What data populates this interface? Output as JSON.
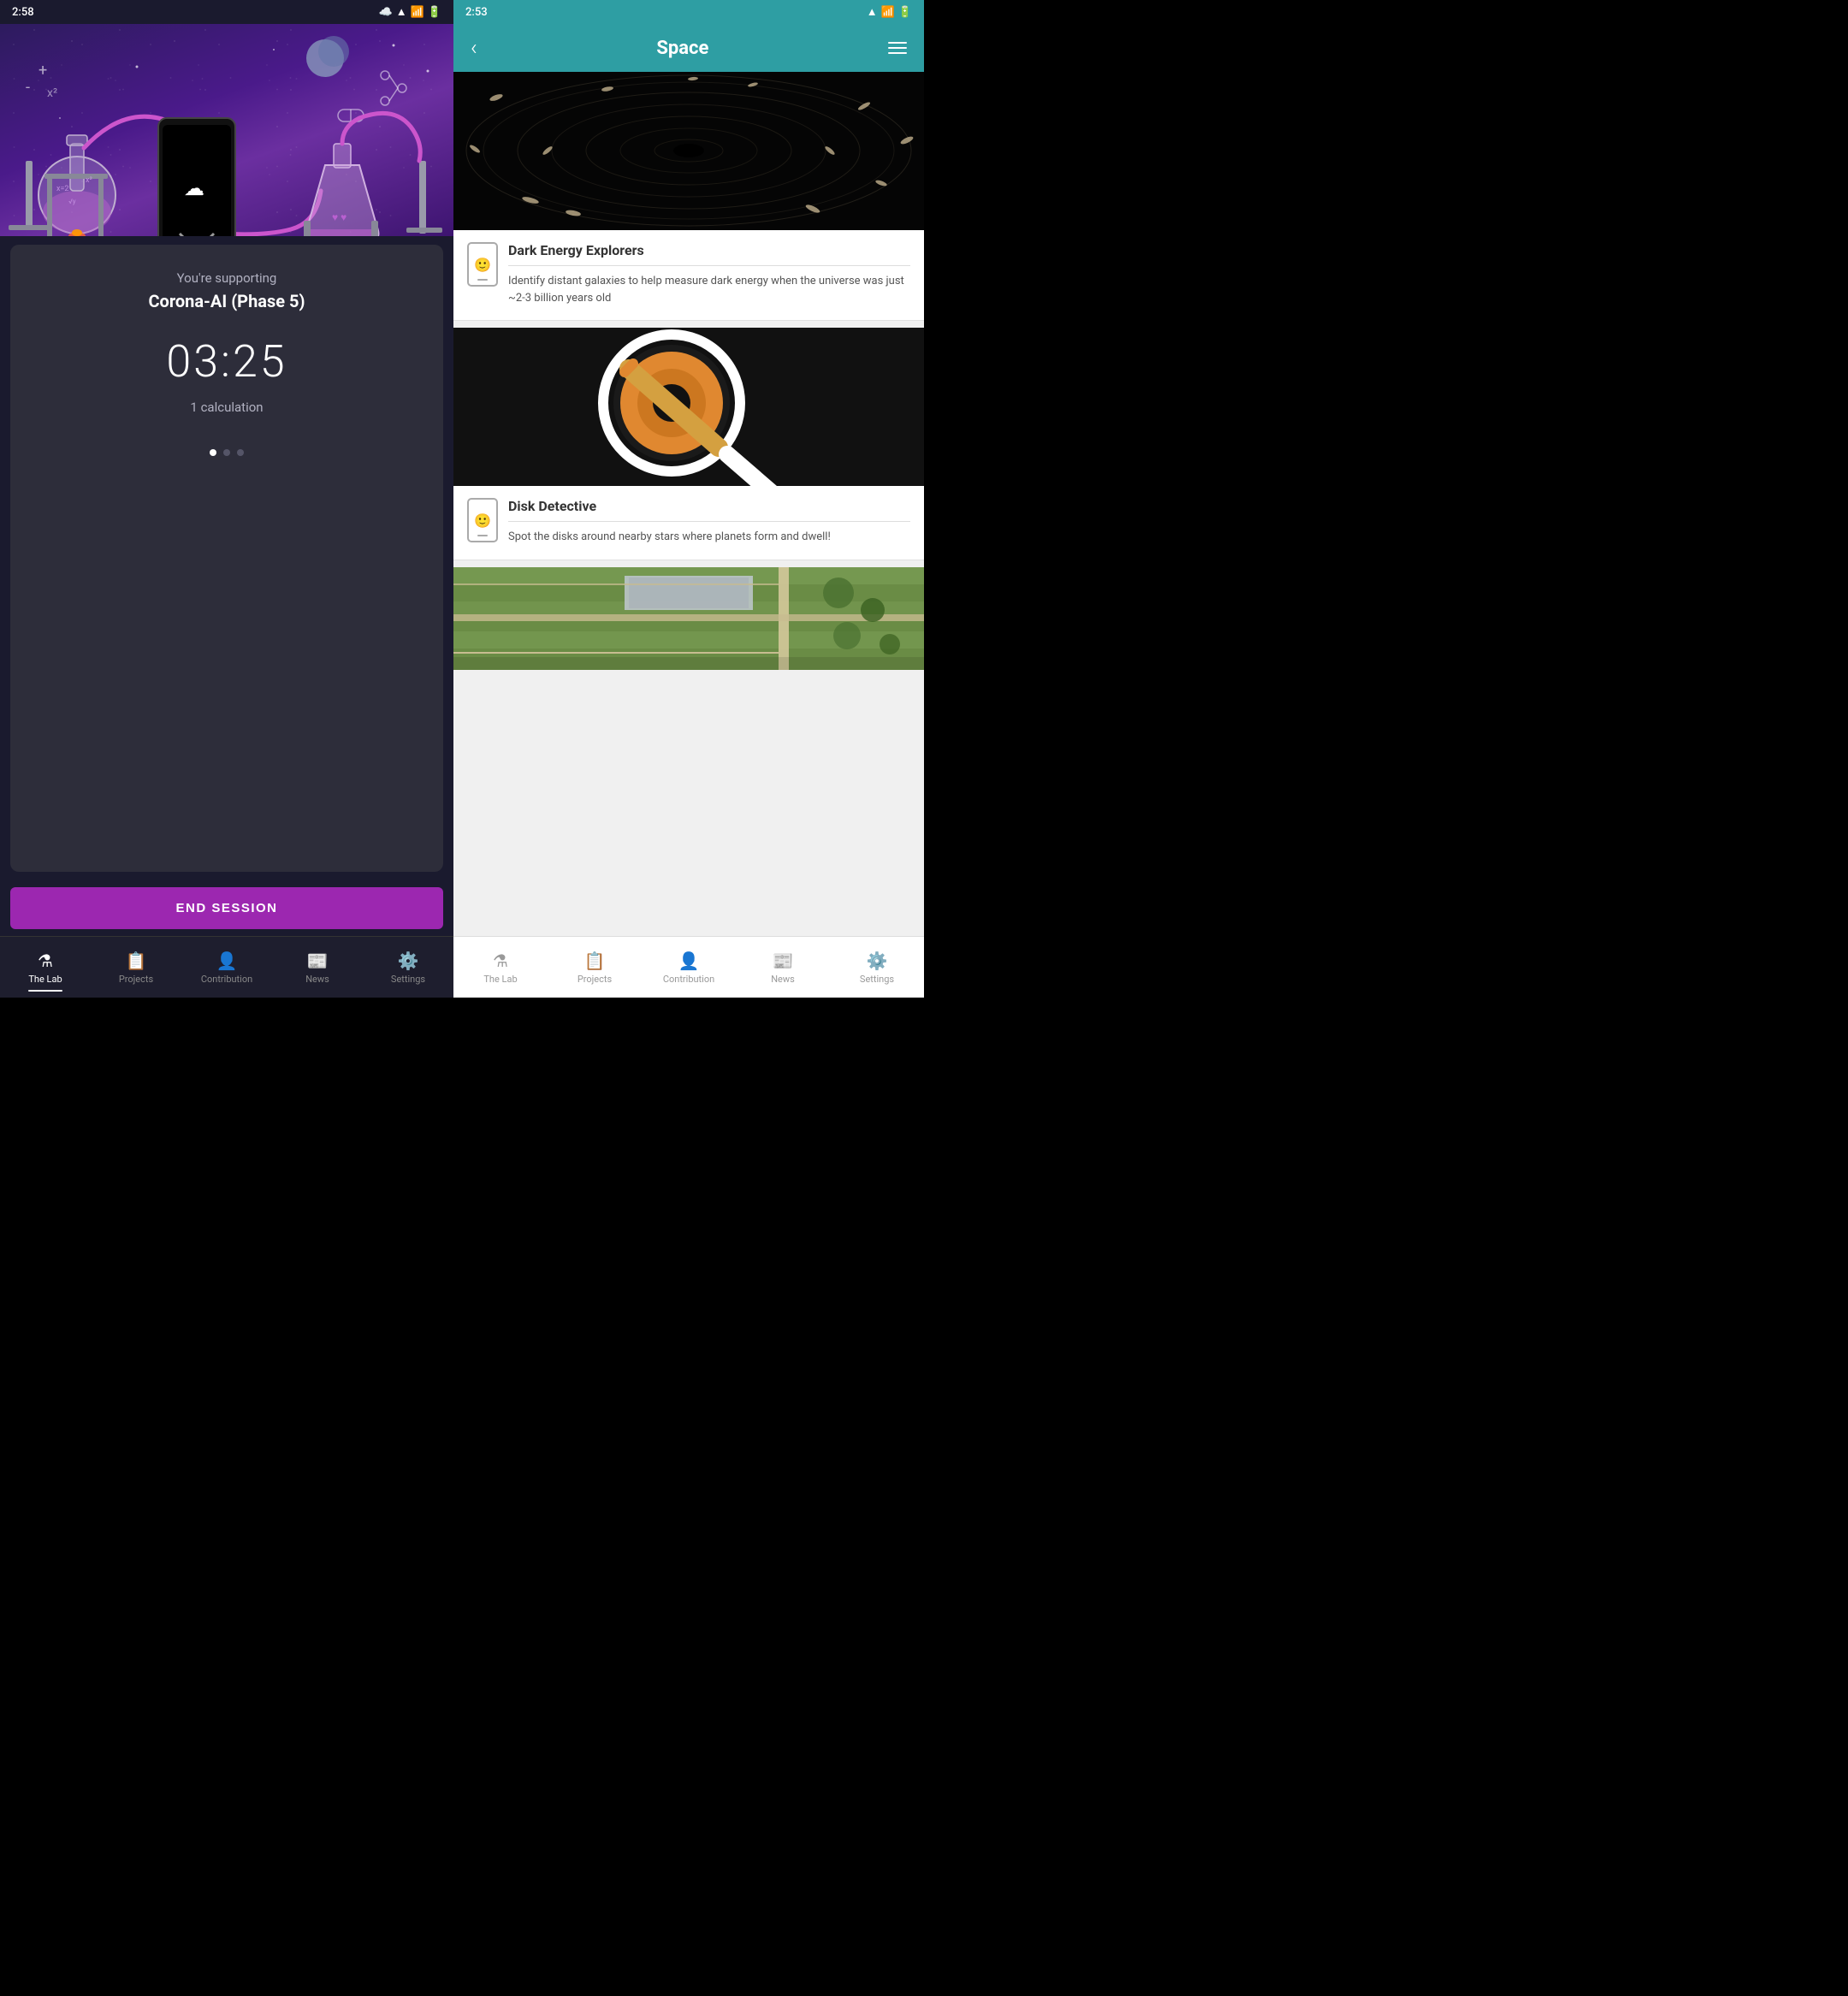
{
  "left": {
    "status_bar": {
      "time": "2:58",
      "icons": [
        "cloud",
        "wifi",
        "signal",
        "battery"
      ]
    },
    "hero": {
      "alt": "Lab illustration with science equipment"
    },
    "info_card": {
      "supporting_label": "You're supporting",
      "project_name": "Corona-AI (Phase 5)",
      "timer": "03:25",
      "calculation_label": "1 calculation",
      "dots": [
        true,
        false,
        false
      ]
    },
    "end_session_button": "END SESSION",
    "nav": {
      "items": [
        {
          "id": "the-lab",
          "label": "The Lab",
          "icon": "🧪",
          "active": true
        },
        {
          "id": "projects",
          "label": "Projects",
          "icon": "📋",
          "active": false
        },
        {
          "id": "contribution",
          "label": "Contribution",
          "icon": "👤",
          "active": false
        },
        {
          "id": "news",
          "label": "News",
          "icon": "📰",
          "active": false
        },
        {
          "id": "settings",
          "label": "Settings",
          "icon": "⚙️",
          "active": false
        }
      ]
    }
  },
  "right": {
    "status_bar": {
      "time": "2:53",
      "icons": [
        "wifi",
        "signal",
        "battery"
      ]
    },
    "header": {
      "back_label": "‹",
      "title": "Space",
      "menu_icon": "hamburger"
    },
    "projects": [
      {
        "id": "dark-energy-explorers",
        "image_type": "galaxy",
        "title": "Dark Energy Explorers",
        "description": "Identify distant galaxies to help measure dark energy when the universe was just ~2-3 billion years old"
      },
      {
        "id": "disk-detective",
        "image_type": "disk",
        "title": "Disk Detective",
        "description": "Spot the disks around nearby stars where planets form and dwell!"
      },
      {
        "id": "aerial",
        "image_type": "aerial",
        "title": "",
        "description": ""
      }
    ]
  },
  "colors": {
    "teal": "#2e9ea3",
    "purple": "#9c27b0",
    "dark_bg": "#2d2d3a",
    "galaxy_gold": "#c8aa78"
  }
}
